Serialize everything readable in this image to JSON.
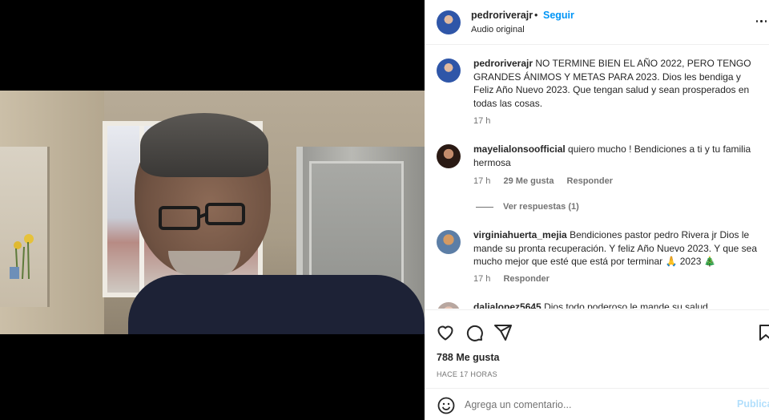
{
  "post": {
    "username": "pedroriverajr",
    "separator": "•",
    "follow_label": "Seguir",
    "audio_label": "Audio original",
    "more_icon": "more-horizontal-icon"
  },
  "caption": {
    "username": "pedroriverajr",
    "text": "NO TERMINE BIEN EL AÑO 2022, PERO TENGO GRANDES ÁNIMOS Y METAS PARA 2023. Dios les bendiga y Feliz Año Nuevo 2023. Que tengan salud y sean prosperados en todas las cosas.",
    "time": "17 h"
  },
  "comments": [
    {
      "username": "mayelialonsoofficial",
      "text": "quiero mucho ! Bendiciones a ti y tu familia hermosa",
      "time": "17 h",
      "likes": "29 Me gusta",
      "reply_label": "Responder",
      "view_replies": "Ver respuestas (1)"
    },
    {
      "username": "virginiahuerta_mejia",
      "text": "Bendiciones pastor pedro Rivera jr Dios le mande su pronta recuperación. Y feliz Año Nuevo 2023. Y que sea mucho mejor que esté que está por terminar 🙏 2023 🎄",
      "time": "17 h",
      "reply_label": "Responder"
    },
    {
      "username": "dalialopez5645",
      "text": "Dios todo poderoso le mande su salud"
    }
  ],
  "stats": {
    "likes": "788 Me gusta",
    "ago": "HACE 17 HORAS"
  },
  "add_comment": {
    "placeholder": "Agrega un comentario...",
    "publish_label": "Publicar"
  },
  "colors": {
    "accent": "#0095f6",
    "publish_disabled": "#b2dffc",
    "text": "#262626",
    "muted": "#737373"
  }
}
